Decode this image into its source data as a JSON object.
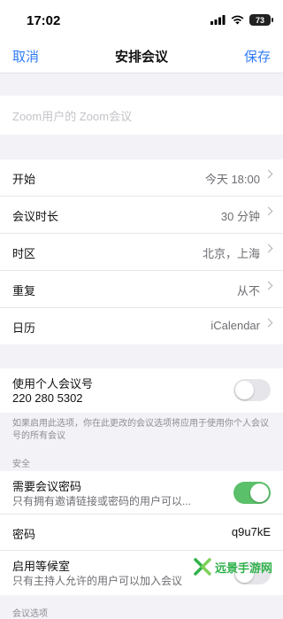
{
  "status_bar": {
    "time": "17:02",
    "battery": "73"
  },
  "nav": {
    "cancel": "取消",
    "title": "安排会议",
    "save": "保存"
  },
  "topic": {
    "placeholder": "Zoom用户的 Zoom会议"
  },
  "schedule": [
    {
      "label": "开始",
      "value": "今天 18:00"
    },
    {
      "label": "会议时长",
      "value": "30 分钟"
    },
    {
      "label": "时区",
      "value": "北京，上海"
    },
    {
      "label": "重复",
      "value": "从不"
    },
    {
      "label": "日历",
      "value": "iCalendar"
    }
  ],
  "pmi": {
    "label": "使用个人会议号",
    "number": "220 280 5302",
    "enabled": false
  },
  "pmi_note": "如果启用此选项，你在此更改的会议选项将应用于使用你个人会议号的所有会议",
  "security": {
    "header": "安全",
    "require_passcode": {
      "title": "需要会议密码",
      "subtitle": "只有拥有邀请链接或密码的用户可以...",
      "enabled": true
    },
    "passcode": {
      "label": "密码",
      "value": "q9u7kE"
    },
    "waiting_room": {
      "title": "启用等候室",
      "subtitle": "只有主持人允许的用户可以加入会议",
      "enabled": false
    }
  },
  "more_header": "会议选项",
  "watermark": {
    "text": "远景手游网"
  },
  "colors": {
    "accent": "#2f7bf5",
    "toggle_on": "#5bc06a",
    "background": "#f2f2f7"
  }
}
